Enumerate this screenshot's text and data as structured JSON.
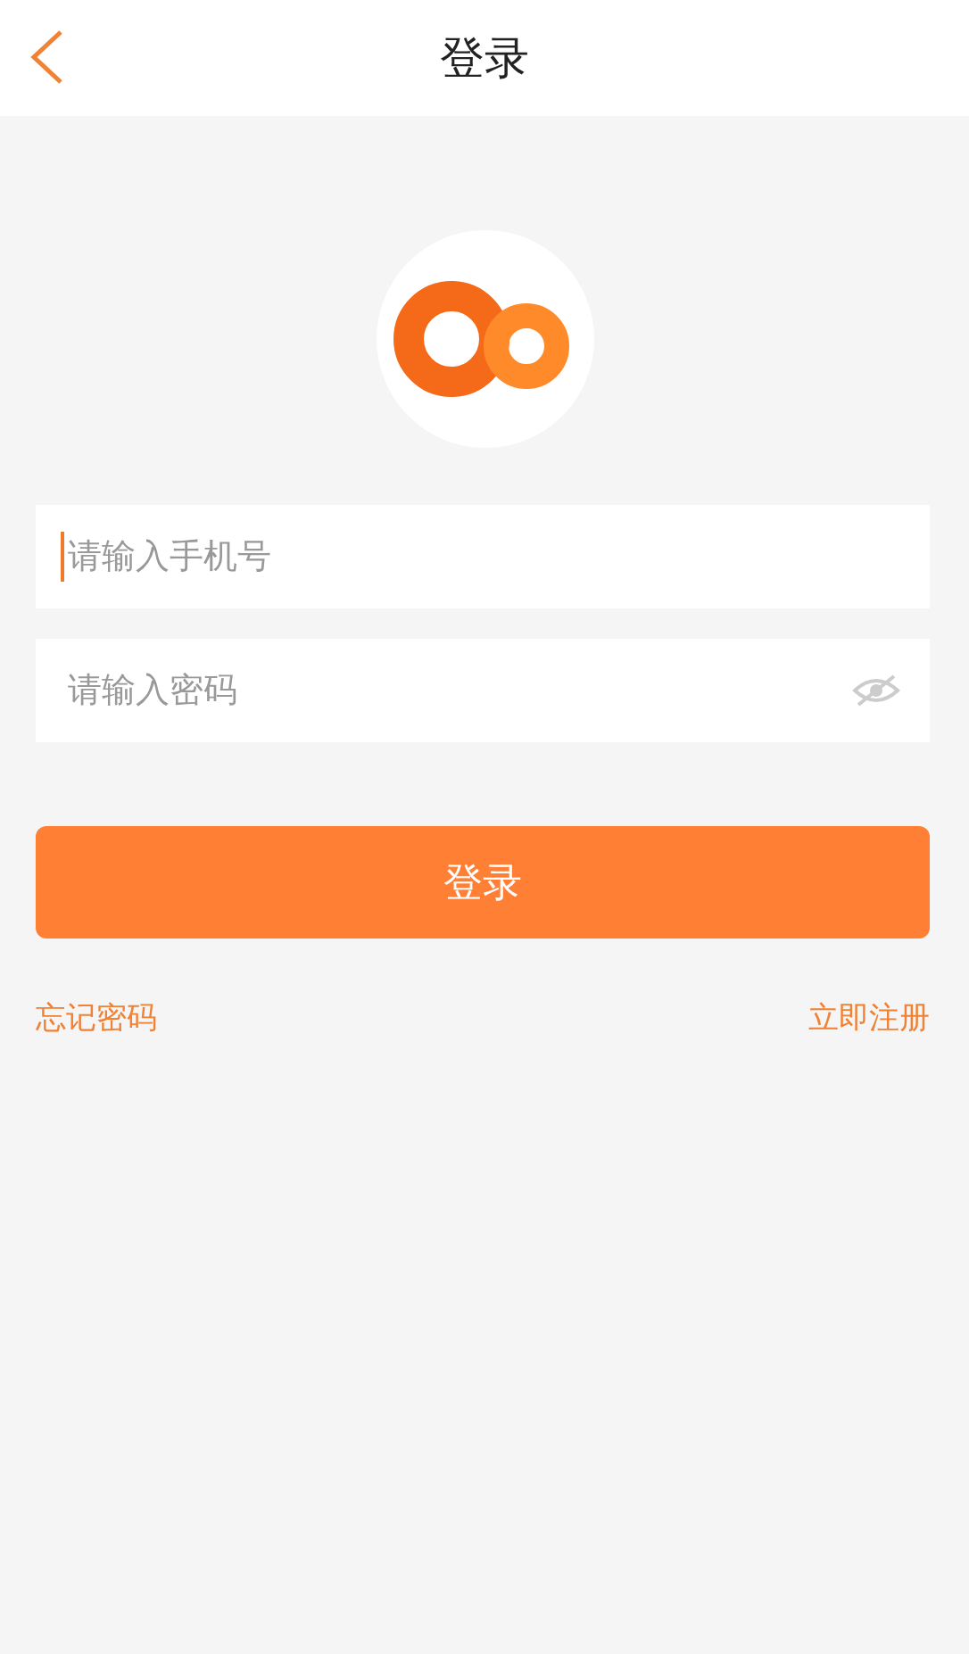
{
  "header": {
    "title": "登录"
  },
  "fields": [
    {
      "kind": "phone",
      "placeholder": "请输入手机号",
      "focused": true
    },
    {
      "kind": "password",
      "placeholder": "请输入密码",
      "focused": false
    }
  ],
  "login_button": {
    "label": "登录"
  },
  "links": [
    {
      "label": "忘记密码"
    },
    {
      "label": "立即注册"
    }
  ]
}
